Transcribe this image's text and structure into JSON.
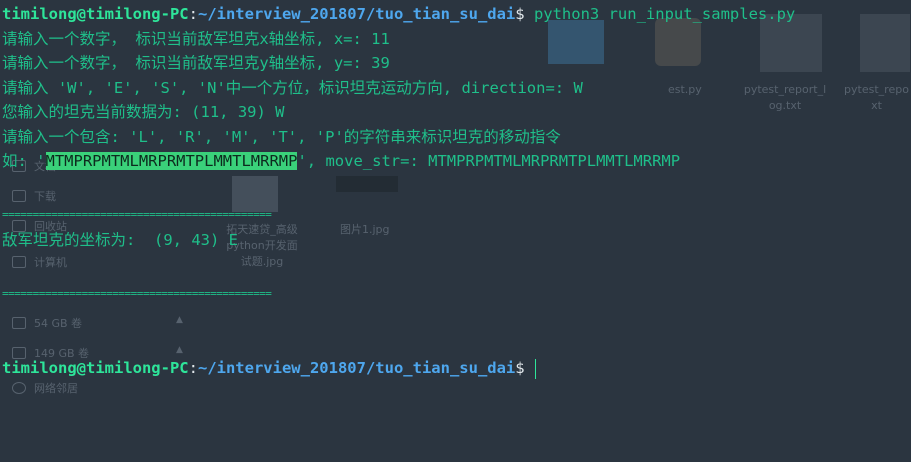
{
  "background_files": {
    "sidebar": [
      {
        "label": "文档",
        "icon": "document-icon"
      },
      {
        "label": "下载",
        "icon": "download-icon"
      },
      {
        "label": "回收站",
        "icon": "trash-icon"
      },
      {
        "label": "计算机",
        "icon": "computer-icon"
      },
      {
        "label": "54 GB 卷",
        "icon": "disk-icon"
      },
      {
        "label": "149 GB 卷",
        "icon": "disk-icon"
      },
      {
        "label": "网络邻居",
        "icon": "network-icon"
      }
    ],
    "files": [
      {
        "label": "est.py"
      },
      {
        "label": "pytest_report_l og.txt"
      },
      {
        "label": "pytest_repo xt"
      },
      {
        "label": "拓天速贷_高级 python开发面 试题.jpg"
      },
      {
        "label": "图片1.jpg"
      }
    ]
  },
  "terminal": {
    "prompt": {
      "user": "timilong@timilong-PC",
      "colon": ":",
      "path": "~/interview_201807/tuo_tian_su_dai",
      "dollar": "$"
    },
    "command": " python3 run_input_samples.py",
    "line_x": "请输入一个数字， 标识当前敌军坦克x轴坐标, x=: 11",
    "line_y": "请输入一个数字， 标识当前敌军坦克y轴坐标, y=: 39",
    "line_dir": "请输入 'W', 'E', 'S', 'N'中一个方位，标识坦克运动方向, direction=: W",
    "line_data": "您输入的坦克当前数据为: (11, 39) W",
    "line_prompt_move": "请输入一个包含: 'L', 'R', 'M', 'T', 'P'的字符串来标识坦克的移动指令",
    "line_example_prefix": "如: '",
    "line_example_highlight": "MTMPRPMTMLMRPRMTPLMMTLMRRMP",
    "line_example_suffix": "', move_str=: MTMPRPMTMLMRPRMTPLMMTLMRRMP",
    "separator_top": "============================================",
    "result": "敌军坦克的坐标为:  (9, 43) E",
    "separator_bottom": "============================================"
  }
}
